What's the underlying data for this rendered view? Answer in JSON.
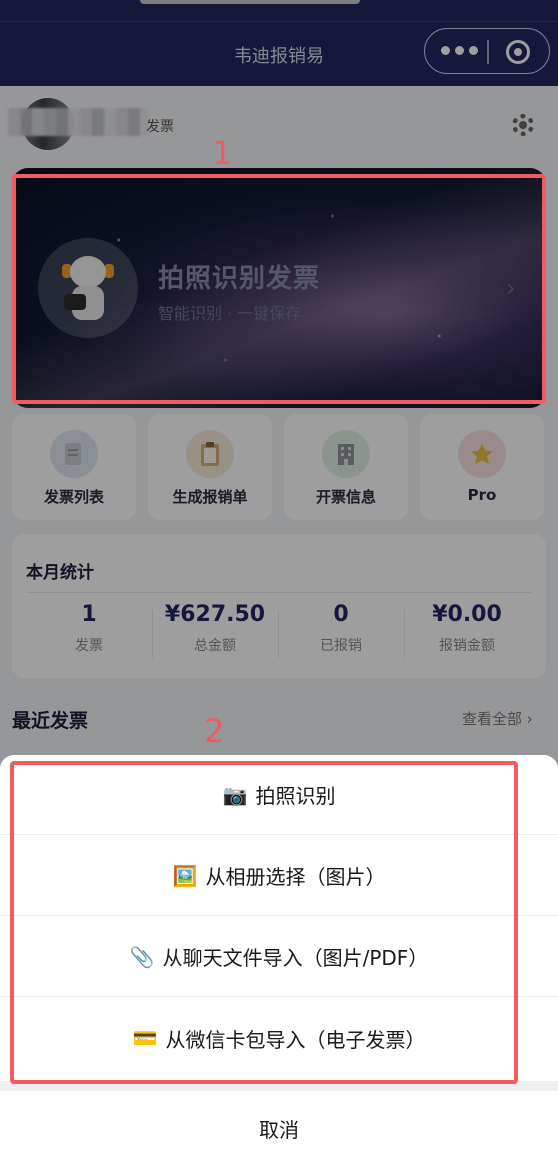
{
  "header": {
    "title": "韦迪报销易"
  },
  "user": {
    "label": "发票"
  },
  "hero": {
    "title": "拍照识别发票",
    "subtitle": "智能识别 · 一键保存",
    "chevron": "›"
  },
  "markers": {
    "first": "1",
    "second": "2"
  },
  "quick_actions": [
    {
      "label": "发票列表",
      "icon": "document-icon",
      "color": "#dfe7f2"
    },
    {
      "label": "生成报销单",
      "icon": "clipboard-icon",
      "color": "#f6ead8"
    },
    {
      "label": "开票信息",
      "icon": "building-icon",
      "color": "#e3efe6"
    },
    {
      "label": "Pro",
      "icon": "star-icon",
      "color": "#f7dfe1"
    }
  ],
  "stats": {
    "title": "本月统计",
    "items": [
      {
        "value": "1",
        "label": "发票"
      },
      {
        "value": "¥627.50",
        "label": "总金额"
      },
      {
        "value": "0",
        "label": "已报销"
      },
      {
        "value": "¥0.00",
        "label": "报销金额"
      }
    ]
  },
  "recent": {
    "title": "最近发票",
    "see_all": "查看全部 ›"
  },
  "sheet": {
    "options": [
      {
        "emoji": "📷",
        "label": "拍照识别"
      },
      {
        "emoji": "🖼️",
        "label": "从相册选择（图片）"
      },
      {
        "emoji": "📎",
        "label": "从聊天文件导入（图片/PDF）"
      },
      {
        "emoji": "💳",
        "label": "从微信卡包导入（电子发票）"
      }
    ],
    "cancel": "取消"
  }
}
